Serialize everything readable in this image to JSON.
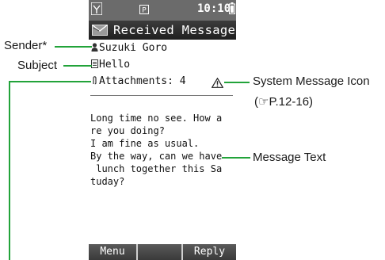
{
  "status_bar": {
    "time": "10:10",
    "icons": [
      "antenna-icon",
      "pin-icon",
      "battery-icon"
    ]
  },
  "title_bar": {
    "title": "Received Message",
    "icon": "envelope-icon"
  },
  "message": {
    "sender": "Suzuki Goro",
    "subject": "Hello",
    "attachments": "Attachments: 4",
    "body": "Long time no see. How a\nre you doing?\nI am fine as usual.\nBy the way, can we have\n lunch together this Sa\ntuday?"
  },
  "softkeys": {
    "left": "Menu",
    "center": "",
    "right": "Reply"
  },
  "callouts": {
    "sender": "Sender*",
    "subject": "Subject",
    "system_icon": "System Message Icon",
    "system_icon_ref": "(☞P.12-16)",
    "message_text": "Message Text"
  },
  "colors": {
    "callout_line": "#22a33a",
    "title_bar_bg": "#2a2a2a",
    "status_bar_bg": "#6b6b6b"
  }
}
